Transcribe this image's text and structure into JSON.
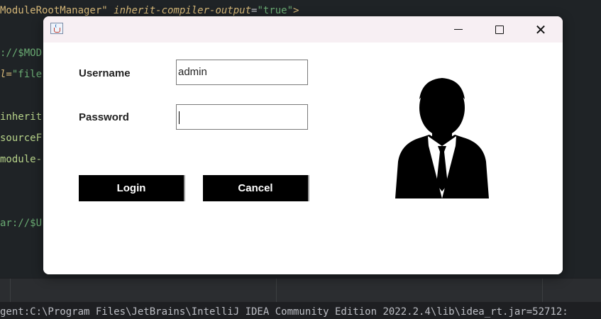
{
  "editor": {
    "lines": [
      {
        "tag": "ModuleRootManager\"",
        "attr": "inherit-compiler-output",
        "eq": "=",
        "value": "\"true\"",
        "tail": ">"
      },
      {
        "text": "://$MOD"
      },
      {
        "pre": "l=",
        "value": "\"file"
      },
      {
        "text": "inherit"
      },
      {
        "text": "sourceF"
      },
      {
        "text": "module-"
      },
      {
        "text": "ar://$U"
      }
    ]
  },
  "console": {
    "text": "gent:C:\\Program Files\\JetBrains\\IntelliJ IDEA Community Edition 2022.2.4\\lib\\idea_rt.jar=52712:"
  },
  "dialog": {
    "title_icon": "java-cup-icon",
    "controls": {
      "minimize": "minimize-icon",
      "maximize": "maximize-icon",
      "close_glyph": "✕"
    },
    "username_label": "Username",
    "username_value": "admin",
    "password_label": "Password",
    "password_value": "",
    "login_label": "Login",
    "cancel_label": "Cancel",
    "avatar_icon": "business-user-icon"
  },
  "colors": {
    "editor_bg": "#1f2326",
    "button_bg": "#000000",
    "titlebar_bg": "#f7eff3"
  }
}
